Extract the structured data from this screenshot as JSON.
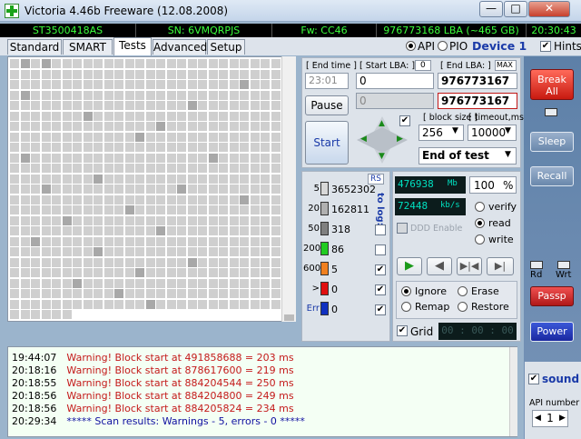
{
  "window": {
    "title": "Victoria 4.46b Freeware (12.08.2008)",
    "controls": {
      "minimize": "—",
      "maximize": "□",
      "close": "✕"
    }
  },
  "info": {
    "model": "ST3500418AS",
    "serial": "SN: 6VMQRPJS",
    "firmware": "Fw: CC46",
    "lba": "976773168 LBA (~465 GB)",
    "clock": "20:30:43"
  },
  "tabs": [
    "Standard",
    "SMART",
    "Tests",
    "Advanced",
    "Setup"
  ],
  "active_tab": "Tests",
  "mode": {
    "api": "API",
    "pio": "PIO",
    "selected": "API",
    "device": "Device 1",
    "hints": "Hints"
  },
  "range": {
    "end_time_label": "[ End time ]",
    "end_time_value": "23:01",
    "start_lba_label": "[ Start LBA: ]",
    "start_lba_zero": "0",
    "start_lba_value": "0",
    "end_lba_label": "[ End LBA: ]",
    "end_lba_max": "MAX",
    "end_lba_value": "976773167",
    "end_lba_value2": "976773167"
  },
  "buttons": {
    "pause": "Pause",
    "start": "Start"
  },
  "params": {
    "block_size_label": "[ block size ]",
    "block_size": "256",
    "timeout_label": "[ timeout,ms ]",
    "timeout": "10000",
    "end_mode": "End of test"
  },
  "stats": {
    "rs": "RS",
    "to_log": "to log:",
    "items": [
      {
        "label": "5",
        "count": "3652302",
        "color": "#d8d8d8"
      },
      {
        "label": "20",
        "count": "162811",
        "color": "#b0b0b0"
      },
      {
        "label": "50",
        "count": "318",
        "color": "#808080"
      },
      {
        "label": "200",
        "count": "86",
        "color": "#22cc22"
      },
      {
        "label": "600",
        "count": "5",
        "color": "#f08020"
      },
      {
        "label": ">",
        "count": "0",
        "color": "#e01010"
      },
      {
        "label": "Err",
        "count": "0",
        "color": "#1030c0"
      }
    ]
  },
  "lcd": {
    "mb": "476938",
    "mb_unit": "Mb",
    "percent": "100",
    "percent_sign": "%",
    "speed": "72448",
    "speed_unit": "kb/s",
    "grid_time": "00 : 00 : 00"
  },
  "verify_modes": {
    "verify": "verify",
    "read": "read",
    "write": "write",
    "selected": "read",
    "ddd": "DDD Enable"
  },
  "actions": {
    "ignore": "Ignore",
    "erase": "Erase",
    "remap": "Remap",
    "restore": "Restore",
    "selected": "Ignore",
    "grid": "Grid"
  },
  "sidebar": {
    "break_all": "Break All",
    "sleep": "Sleep",
    "recall": "Recall",
    "rd": "Rd",
    "wrt": "Wrt",
    "passp": "Passp",
    "power": "Power",
    "sound": "sound",
    "api_number_label": "API number",
    "api_number": "1"
  },
  "log": [
    {
      "time": "19:44:07",
      "msg": "Warning! Block start at 491858688 = 203 ms"
    },
    {
      "time": "20:18:16",
      "msg": "Warning! Block start at 878617600 = 219 ms"
    },
    {
      "time": "20:18:55",
      "msg": "Warning! Block start at 884204544 = 250 ms"
    },
    {
      "time": "20:18:56",
      "msg": "Warning! Block start at 884204800 = 249 ms"
    },
    {
      "time": "20:18:56",
      "msg": "Warning! Block start at 884205824 = 234 ms"
    },
    {
      "time": "20:29:34",
      "msg": "***** Scan results: Warnings - 5, errors - 0 *****"
    }
  ]
}
